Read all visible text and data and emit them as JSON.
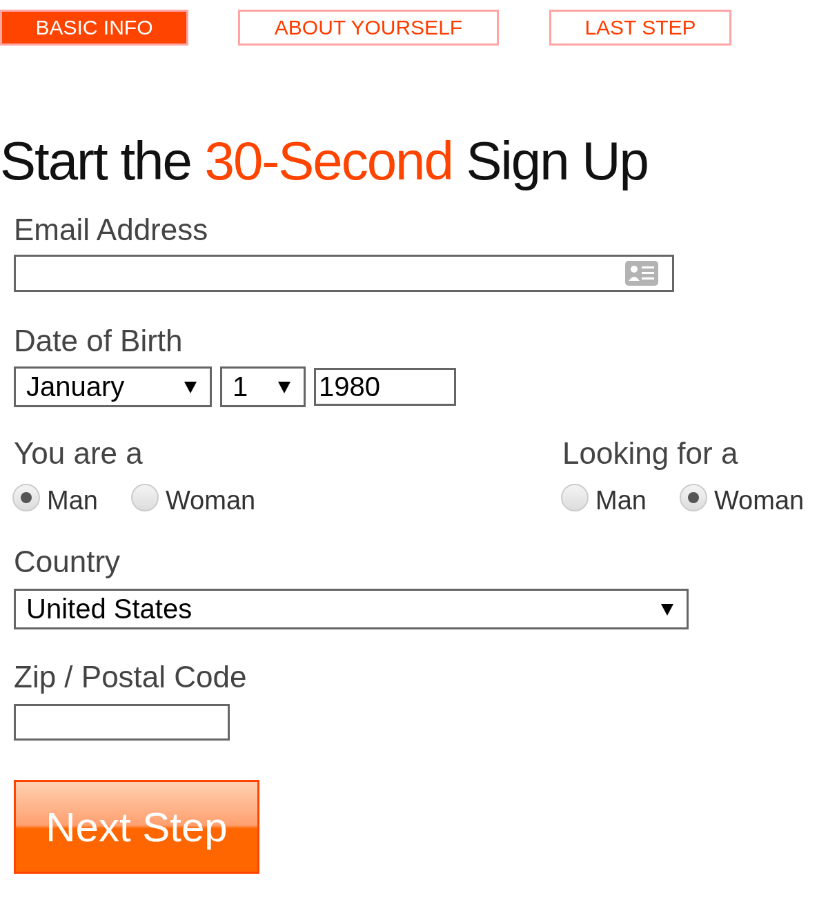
{
  "tabs": [
    {
      "label": "BASIC INFO",
      "selected": true
    },
    {
      "label": "ABOUT YOURSELF",
      "selected": false
    },
    {
      "label": "LAST STEP",
      "selected": false
    }
  ],
  "heading": [
    {
      "text": "Start the ",
      "highlight": false
    },
    {
      "text": "30-Second",
      "highlight": true
    },
    {
      "text": " Sign Up",
      "highlight": false
    }
  ],
  "email": {
    "label": "Email Address"
  },
  "date_of_birth": {
    "label": "Date of Birth",
    "month": "January",
    "day": "1",
    "year": "1980"
  },
  "gender_groups": [
    {
      "label": "You are a",
      "options": [
        {
          "label": "Man",
          "selected": true
        },
        {
          "label": "Woman",
          "selected": false
        }
      ]
    },
    {
      "label": "Looking for a",
      "options": [
        {
          "label": "Man",
          "selected": false
        },
        {
          "label": "Woman",
          "selected": true
        }
      ]
    }
  ],
  "country": {
    "label": "Country",
    "value": "United States"
  },
  "zip": {
    "label": "Zip / Postal Code"
  },
  "next_button": "Next Step"
}
